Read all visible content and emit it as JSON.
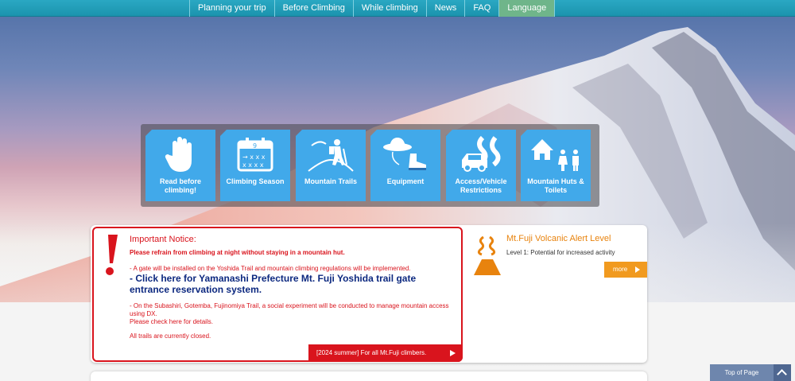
{
  "nav": {
    "items": [
      {
        "label": "Planning your trip"
      },
      {
        "label": "Before Climbing"
      },
      {
        "label": "While climbing"
      },
      {
        "label": "News"
      },
      {
        "label": "FAQ"
      },
      {
        "label": "Language",
        "active": true
      }
    ]
  },
  "tiles": [
    {
      "label": "Read before climbing!",
      "icon": "hand-icon"
    },
    {
      "label": "Climbing Season",
      "icon": "calendar-icon"
    },
    {
      "label": "Mountain Trails",
      "icon": "hiker-icon"
    },
    {
      "label": "Equipment",
      "icon": "hat-boot-icon"
    },
    {
      "label": "Access/Vehicle Restrictions",
      "icon": "car-road-icon"
    },
    {
      "label": "Mountain Huts & Toilets",
      "icon": "hut-toilet-icon"
    }
  ],
  "notice": {
    "title": "Important Notice:",
    "line1": "Please refrain from climbing at night without staying in a mountain hut.",
    "line2": "- A gate will be installed on the Yoshida Trail and mountain climbing regulations will be implemented.",
    "line3": "- Click here for Yamanashi Prefecture Mt. Fuji Yoshida trail gate entrance reservation system.",
    "line4a": "- On the Subashiri, Gotemba, Fujinomiya Trail, a social experiment will be conducted to manage mountain access using DX.",
    "line4b": "Please check here for details.",
    "line5": "All trails are currently closed.",
    "summer_button": "[2024 summer] For all Mt.Fuji climbers."
  },
  "alert": {
    "title": "Mt.Fuji Volcanic Alert Level",
    "level": "Level 1: Potential for increased activity",
    "more": "more"
  },
  "top_of_page": "Top of Page",
  "colors": {
    "nav_bg": "#1b93ad",
    "tile_blue": "#41a9ea",
    "notice_red": "#d9141d",
    "link_navy": "#0d2980",
    "alert_orange": "#e8830e",
    "language_green": "#6fb58a"
  }
}
